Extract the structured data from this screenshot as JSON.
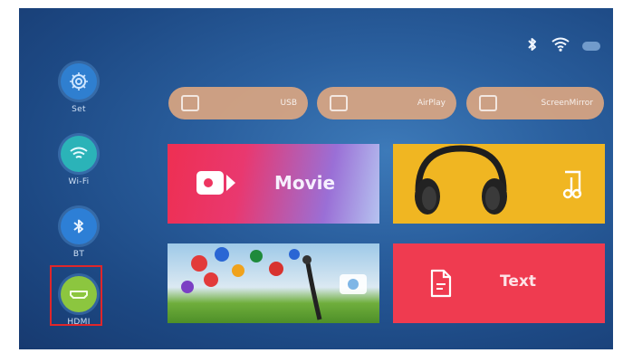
{
  "status": {
    "bluetooth_icon": "bluetooth-icon",
    "wifi_icon": "wifi-icon",
    "battery_icon": "battery-icon"
  },
  "sidebar": {
    "items": [
      {
        "label": "Set",
        "icon": "gear-icon",
        "color": "#2f7fd0"
      },
      {
        "label": "Wi-Fi",
        "icon": "wifi-icon",
        "color": "#2bb3b8"
      },
      {
        "label": "BT",
        "icon": "bluetooth-icon",
        "color": "#2d7fd6"
      },
      {
        "label": "HDMI",
        "icon": "hdmi-icon",
        "color": "#8cc63f",
        "selected": true
      }
    ]
  },
  "quick_bar": [
    {
      "label": "USB",
      "icon": "usb-icon"
    },
    {
      "label": "AirPlay",
      "icon": "airplay-icon"
    },
    {
      "label": "ScreenMirror",
      "icon": "screen-mirror-icon"
    }
  ],
  "tiles": {
    "movie": {
      "label": "Movie",
      "icon": "video-camera-icon"
    },
    "music": {
      "icon": "music-note-icon"
    },
    "photo": {
      "icon": "camera-icon"
    },
    "text": {
      "label": "Text",
      "icon": "document-icon"
    }
  },
  "colors": {
    "selection": "#e0262a",
    "movie": "#e8325a",
    "music": "#f0b622",
    "text": "#ef3b50"
  }
}
